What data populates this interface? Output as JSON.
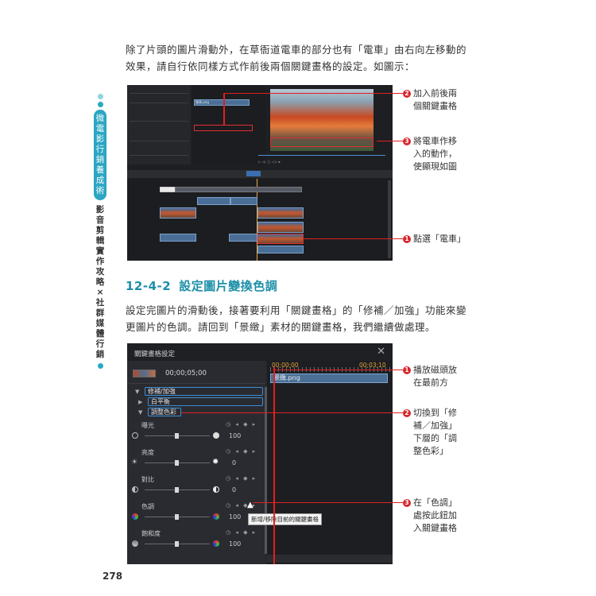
{
  "paragraphs": {
    "p1": "除了片頭的圖片滑動外，在草衙道電車的部分也有「電車」由右向左移動的效果，請自行依同樣方式作前後兩個關鍵畫格的設定。如圖示：",
    "p2": "設定完圖片的滑動後，接著要利用「關鍵畫格」的「修補／加強」功能來變更圖片的色調。請回到「景緻」素材的關鍵畫格，我們繼續做處理。"
  },
  "section": {
    "number": "12-4-2",
    "title": "設定圖片變換色調"
  },
  "side_tab": {
    "main": "微電影行銷養成術",
    "sub": "影音剪輯實作攻略×社群媒體行銷"
  },
  "page_number": "278",
  "colors": {
    "accent": "#1c8fa8",
    "callout_red": "#d9262c",
    "tab_blue": "#2aa6c2"
  },
  "callouts1": [
    {
      "n": "2",
      "lines": [
        "加入前後兩",
        "個關鍵畫格"
      ]
    },
    {
      "n": "3",
      "lines": [
        "將電車作移",
        "入的動作，",
        "使顯現如圖"
      ]
    },
    {
      "n": "1",
      "lines": [
        "點選「電車」"
      ]
    }
  ],
  "callouts2": [
    {
      "n": "1",
      "lines": [
        "播放磁頭放",
        "在最前方"
      ]
    },
    {
      "n": "2",
      "lines": [
        "切換到「修",
        "補／加強」",
        "下層的「調",
        "整色彩」"
      ]
    },
    {
      "n": "3",
      "lines": [
        "在「色調」",
        "處按此鈕加",
        "入關鍵畫格"
      ]
    }
  ],
  "shot2": {
    "title": "關鍵畫格設定",
    "close_icon": "close-icon",
    "timecode": "00;00;05;00",
    "ruler_start": "00;00;00",
    "ruler_end": "00;03;10",
    "clip_name": "景緻.png",
    "tree": {
      "parent": "修補/加強",
      "child1": "白平衡",
      "child2": "調整色彩"
    },
    "props": [
      {
        "label": "曝光",
        "value": "100"
      },
      {
        "label": "亮度",
        "value": "0"
      },
      {
        "label": "對比",
        "value": "0"
      },
      {
        "label": "色調",
        "value": "100"
      },
      {
        "label": "飽和度",
        "value": "100"
      }
    ],
    "tooltip": "新增/移除目前的關鍵畫格"
  },
  "shot1": {
    "clip_label": "電車.png"
  }
}
